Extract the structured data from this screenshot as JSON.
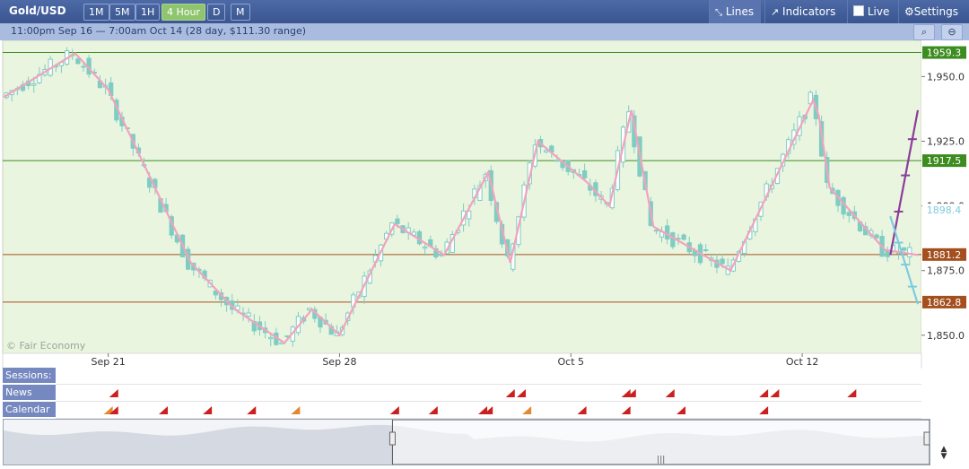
{
  "toolbar": {
    "symbol": "Gold/USD",
    "timeframes": [
      {
        "label": "1M",
        "active": false
      },
      {
        "label": "5M",
        "active": false
      },
      {
        "label": "1H",
        "active": false
      },
      {
        "label": "4 Hour",
        "active": true
      },
      {
        "label": "D",
        "active": false
      },
      {
        "label": "M",
        "active": false
      }
    ],
    "lines_label": "Lines",
    "indicators_label": "Indicators",
    "live_label": "Live",
    "settings_label": "Settings"
  },
  "subheader": {
    "range_text": "11:00pm Sep 16 — 7:00am Oct 14 (28 day, $111.30 range)"
  },
  "watermark": "© Fair Economy",
  "rows": {
    "sessions_label": "Sessions:",
    "news_label": "News",
    "calendar_label": "Calendar"
  },
  "colors": {
    "plot_bg": "#eaf5e0",
    "candle": "#7ecdc3",
    "zigzag": "#f2a3bd",
    "green_level": "#3d8c1f",
    "brown_level": "#a3501e",
    "projection_up": "#8a3d99",
    "projection_down": "#7ecbe0",
    "toolbar": "#3f5b97"
  },
  "chart_data": {
    "type": "candlestick",
    "title": "",
    "ylim": [
      1843,
      1964
    ],
    "yticks": [
      1950,
      1925,
      1900,
      1875,
      1850
    ],
    "ytick_labels": [
      "1,950.0",
      "1,925.0",
      "1,900.0",
      "1,875.0",
      "1,850.0"
    ],
    "xticks": [
      "Sep 21",
      "Sep 28",
      "Oct 5",
      "Oct 12"
    ],
    "xtick_bars": [
      19,
      61,
      103,
      145
    ],
    "bar_count": 166,
    "current_price": 1898.4,
    "levels": [
      {
        "value": 1959.3,
        "label": "1959.3",
        "color": "green"
      },
      {
        "value": 1917.5,
        "label": "1917.5",
        "color": "green"
      },
      {
        "value": 1881.2,
        "label": "1881.2",
        "color": "brown"
      },
      {
        "value": 1862.8,
        "label": "1862.8",
        "color": "brown"
      }
    ],
    "zigzag": [
      [
        0,
        1942
      ],
      [
        13,
        1959
      ],
      [
        19,
        1945
      ],
      [
        34,
        1878
      ],
      [
        42,
        1860
      ],
      [
        51,
        1847
      ],
      [
        56,
        1860
      ],
      [
        61,
        1850
      ],
      [
        71,
        1893
      ],
      [
        80,
        1881
      ],
      [
        88,
        1913
      ],
      [
        92,
        1878
      ],
      [
        97,
        1925
      ],
      [
        106,
        1909
      ],
      [
        110,
        1900
      ],
      [
        114,
        1937
      ],
      [
        118,
        1892
      ],
      [
        132,
        1875
      ],
      [
        147,
        1941
      ],
      [
        148,
        1935
      ],
      [
        150,
        1907
      ],
      [
        160,
        1883
      ],
      [
        166,
        1881
      ]
    ],
    "projection_up": [
      [
        161,
        1881
      ],
      [
        166,
        1937
      ]
    ],
    "projection_down": [
      [
        161,
        1896
      ],
      [
        166,
        1862
      ]
    ],
    "news_markers": {
      "news": [
        20,
        92,
        94,
        113,
        114,
        121,
        138,
        140,
        154
      ],
      "calendar": [
        19,
        20,
        29,
        37,
        45,
        53,
        71,
        78,
        87,
        88,
        95,
        105,
        113,
        123,
        138
      ]
    },
    "navigator_window": [
      0.42,
      1.0
    ]
  }
}
